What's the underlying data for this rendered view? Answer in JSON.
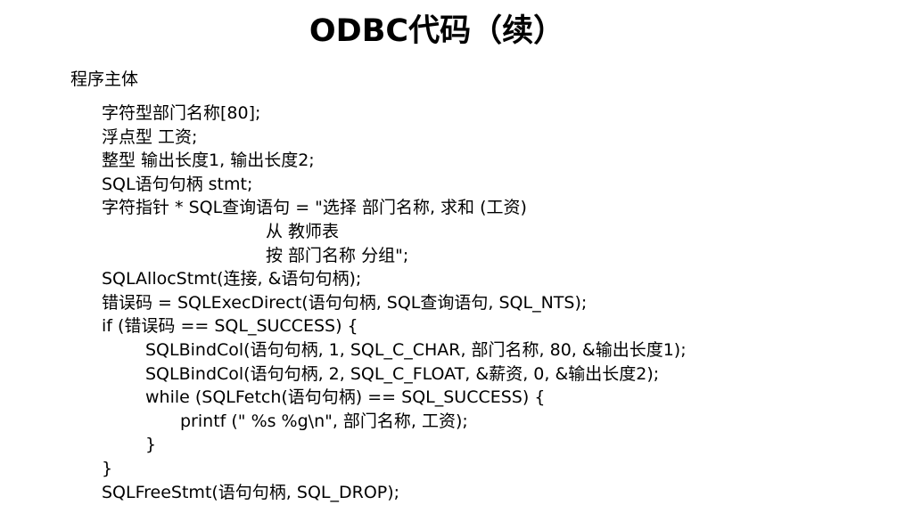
{
  "slide": {
    "title": "ODBC代码（续）",
    "section_label": "程序主体"
  },
  "code": {
    "lines": [
      {
        "indent": "0",
        "text": "字符型部门名称[80];"
      },
      {
        "indent": "0",
        "text": "浮点型 工资;"
      },
      {
        "indent": "0",
        "text": "整型 输出长度1, 输出长度2;"
      },
      {
        "indent": "0",
        "text": "SQL语句句柄 stmt;"
      },
      {
        "indent": "0",
        "text": "字符指针 * SQL查询语句 = \"选择 部门名称, 求和 (工资)"
      },
      {
        "indent": "cont",
        "text": "从 教师表"
      },
      {
        "indent": "cont",
        "text": "按 部门名称 分组\";"
      },
      {
        "indent": "0",
        "text": "SQLAllocStmt(连接, &语句句柄);"
      },
      {
        "indent": "0",
        "text": "错误码 = SQLExecDirect(语句句柄, SQL查询语句, SQL_NTS);"
      },
      {
        "indent": "0",
        "text": "if (错误码 == SQL_SUCCESS) {"
      },
      {
        "indent": "1",
        "text": "SQLBindCol(语句句柄, 1, SQL_C_CHAR, 部门名称, 80, &输出长度1);"
      },
      {
        "indent": "1",
        "text": "SQLBindCol(语句句柄, 2, SQL_C_FLOAT, &薪资, 0, &输出长度2);"
      },
      {
        "indent": "1",
        "text": "while (SQLFetch(语句句柄) == SQL_SUCCESS) {"
      },
      {
        "indent": "2",
        "text": "printf (\" %s %g\\n\", 部门名称, 工资);"
      },
      {
        "indent": "1",
        "text": "}"
      },
      {
        "indent": "0",
        "text": "}"
      },
      {
        "indent": "0",
        "text": "SQLFreeStmt(语句句柄, SQL_DROP);"
      }
    ]
  }
}
